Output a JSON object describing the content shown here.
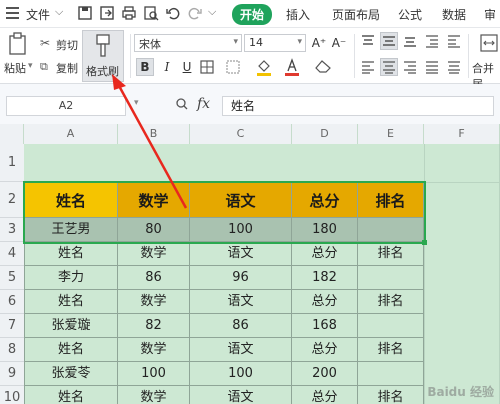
{
  "quickbar": {
    "file_label": "文件"
  },
  "tabs": [
    {
      "label": "开始",
      "active": true
    },
    {
      "label": "插入",
      "active": false
    },
    {
      "label": "页面布局",
      "active": false
    },
    {
      "label": "公式",
      "active": false
    },
    {
      "label": "数据",
      "active": false
    },
    {
      "label": "审",
      "active": false
    }
  ],
  "ribbon": {
    "paste_label": "粘贴",
    "cut_label": "剪切",
    "copy_label": "复制",
    "format_painter_label": "格式刷",
    "font_name": "宋体",
    "font_size": "14",
    "grow_font": "A⁺",
    "shrink_font": "A⁻",
    "bold": "B",
    "italic": "I",
    "underline": "U",
    "merge_label": "合并居",
    "accent_color": "#1fa35c",
    "font_color": "#e03a2f",
    "fill_color": "#f2c200"
  },
  "formula_bar": {
    "cell_ref": "A2",
    "fx": "fx",
    "content": "姓名"
  },
  "columns": [
    "A",
    "B",
    "C",
    "D",
    "E",
    "F"
  ],
  "rows": [
    "1",
    "2",
    "3",
    "4",
    "5",
    "6",
    "7",
    "8",
    "9",
    "10"
  ],
  "table": {
    "header": [
      "姓名",
      "数学",
      "语文",
      "总分",
      "排名"
    ],
    "body": [
      [
        "王艺男",
        "80",
        "100",
        "180",
        ""
      ],
      [
        "姓名",
        "数学",
        "语文",
        "总分",
        "排名"
      ],
      [
        "李力",
        "86",
        "96",
        "182",
        ""
      ],
      [
        "姓名",
        "数学",
        "语文",
        "总分",
        "排名"
      ],
      [
        "张爱璇",
        "82",
        "86",
        "168",
        ""
      ],
      [
        "姓名",
        "数学",
        "语文",
        "总分",
        "排名"
      ],
      [
        "张爱苓",
        "100",
        "100",
        "200",
        ""
      ],
      [
        "姓名",
        "数学",
        "语文",
        "总分",
        "排名"
      ]
    ]
  },
  "header_colors": {
    "first": "#f5c400",
    "rest": "#e5a800"
  },
  "watermark": "Baidu 经验"
}
